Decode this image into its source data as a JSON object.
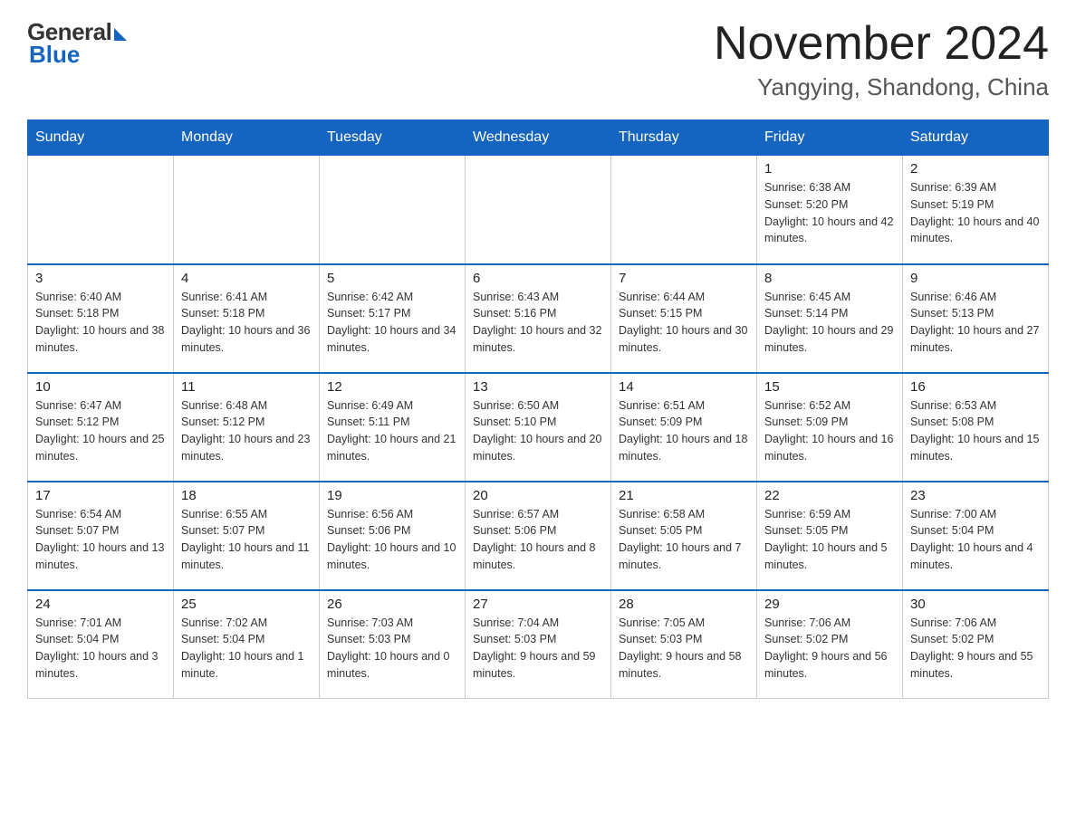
{
  "header": {
    "logo": {
      "general": "General",
      "blue": "Blue"
    },
    "month_title": "November 2024",
    "location": "Yangying, Shandong, China"
  },
  "weekdays": [
    "Sunday",
    "Monday",
    "Tuesday",
    "Wednesday",
    "Thursday",
    "Friday",
    "Saturday"
  ],
  "weeks": [
    [
      {
        "day": "",
        "info": ""
      },
      {
        "day": "",
        "info": ""
      },
      {
        "day": "",
        "info": ""
      },
      {
        "day": "",
        "info": ""
      },
      {
        "day": "",
        "info": ""
      },
      {
        "day": "1",
        "info": "Sunrise: 6:38 AM\nSunset: 5:20 PM\nDaylight: 10 hours and 42 minutes."
      },
      {
        "day": "2",
        "info": "Sunrise: 6:39 AM\nSunset: 5:19 PM\nDaylight: 10 hours and 40 minutes."
      }
    ],
    [
      {
        "day": "3",
        "info": "Sunrise: 6:40 AM\nSunset: 5:18 PM\nDaylight: 10 hours and 38 minutes."
      },
      {
        "day": "4",
        "info": "Sunrise: 6:41 AM\nSunset: 5:18 PM\nDaylight: 10 hours and 36 minutes."
      },
      {
        "day": "5",
        "info": "Sunrise: 6:42 AM\nSunset: 5:17 PM\nDaylight: 10 hours and 34 minutes."
      },
      {
        "day": "6",
        "info": "Sunrise: 6:43 AM\nSunset: 5:16 PM\nDaylight: 10 hours and 32 minutes."
      },
      {
        "day": "7",
        "info": "Sunrise: 6:44 AM\nSunset: 5:15 PM\nDaylight: 10 hours and 30 minutes."
      },
      {
        "day": "8",
        "info": "Sunrise: 6:45 AM\nSunset: 5:14 PM\nDaylight: 10 hours and 29 minutes."
      },
      {
        "day": "9",
        "info": "Sunrise: 6:46 AM\nSunset: 5:13 PM\nDaylight: 10 hours and 27 minutes."
      }
    ],
    [
      {
        "day": "10",
        "info": "Sunrise: 6:47 AM\nSunset: 5:12 PM\nDaylight: 10 hours and 25 minutes."
      },
      {
        "day": "11",
        "info": "Sunrise: 6:48 AM\nSunset: 5:12 PM\nDaylight: 10 hours and 23 minutes."
      },
      {
        "day": "12",
        "info": "Sunrise: 6:49 AM\nSunset: 5:11 PM\nDaylight: 10 hours and 21 minutes."
      },
      {
        "day": "13",
        "info": "Sunrise: 6:50 AM\nSunset: 5:10 PM\nDaylight: 10 hours and 20 minutes."
      },
      {
        "day": "14",
        "info": "Sunrise: 6:51 AM\nSunset: 5:09 PM\nDaylight: 10 hours and 18 minutes."
      },
      {
        "day": "15",
        "info": "Sunrise: 6:52 AM\nSunset: 5:09 PM\nDaylight: 10 hours and 16 minutes."
      },
      {
        "day": "16",
        "info": "Sunrise: 6:53 AM\nSunset: 5:08 PM\nDaylight: 10 hours and 15 minutes."
      }
    ],
    [
      {
        "day": "17",
        "info": "Sunrise: 6:54 AM\nSunset: 5:07 PM\nDaylight: 10 hours and 13 minutes."
      },
      {
        "day": "18",
        "info": "Sunrise: 6:55 AM\nSunset: 5:07 PM\nDaylight: 10 hours and 11 minutes."
      },
      {
        "day": "19",
        "info": "Sunrise: 6:56 AM\nSunset: 5:06 PM\nDaylight: 10 hours and 10 minutes."
      },
      {
        "day": "20",
        "info": "Sunrise: 6:57 AM\nSunset: 5:06 PM\nDaylight: 10 hours and 8 minutes."
      },
      {
        "day": "21",
        "info": "Sunrise: 6:58 AM\nSunset: 5:05 PM\nDaylight: 10 hours and 7 minutes."
      },
      {
        "day": "22",
        "info": "Sunrise: 6:59 AM\nSunset: 5:05 PM\nDaylight: 10 hours and 5 minutes."
      },
      {
        "day": "23",
        "info": "Sunrise: 7:00 AM\nSunset: 5:04 PM\nDaylight: 10 hours and 4 minutes."
      }
    ],
    [
      {
        "day": "24",
        "info": "Sunrise: 7:01 AM\nSunset: 5:04 PM\nDaylight: 10 hours and 3 minutes."
      },
      {
        "day": "25",
        "info": "Sunrise: 7:02 AM\nSunset: 5:04 PM\nDaylight: 10 hours and 1 minute."
      },
      {
        "day": "26",
        "info": "Sunrise: 7:03 AM\nSunset: 5:03 PM\nDaylight: 10 hours and 0 minutes."
      },
      {
        "day": "27",
        "info": "Sunrise: 7:04 AM\nSunset: 5:03 PM\nDaylight: 9 hours and 59 minutes."
      },
      {
        "day": "28",
        "info": "Sunrise: 7:05 AM\nSunset: 5:03 PM\nDaylight: 9 hours and 58 minutes."
      },
      {
        "day": "29",
        "info": "Sunrise: 7:06 AM\nSunset: 5:02 PM\nDaylight: 9 hours and 56 minutes."
      },
      {
        "day": "30",
        "info": "Sunrise: 7:06 AM\nSunset: 5:02 PM\nDaylight: 9 hours and 55 minutes."
      }
    ]
  ]
}
